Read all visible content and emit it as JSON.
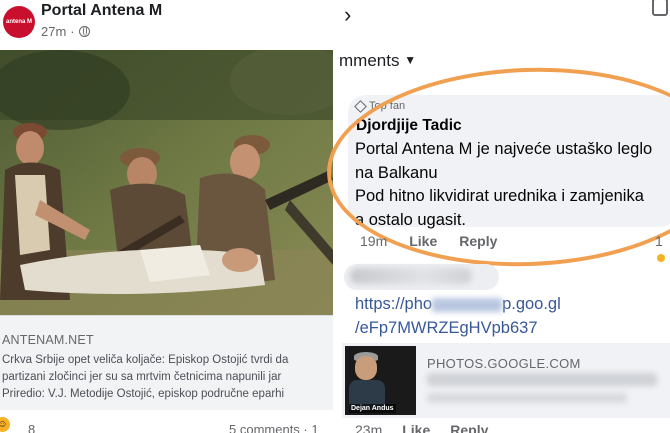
{
  "left_post": {
    "page_name": "Portal Antena M",
    "logo_text": "antena M",
    "time": "27m",
    "separator": "·",
    "link": {
      "domain": "ANTENAM.NET",
      "text_lines": [
        "Crkva Srbije opet veliča koljače: Episkop Ostojić tvrdi da",
        "partizani zločinci jer su sa mrtvim četnicima napunili jar",
        "Priredio: V.J. Metodije Ostojić, episkop područne eparhi"
      ]
    },
    "reactions": {
      "count": "8"
    },
    "comments_count": "5 comments · 1"
  },
  "right_panel": {
    "back_icon": "›",
    "comments_header": "mments",
    "comment": {
      "badge": "Top fan",
      "author": "Djordjije Tadic",
      "text_lines": [
        "Portal Antena M je najveće ustaško leglo",
        "na Balkanu",
        "Pod hitno likvidirat urednika i zamjenika",
        "a ostalo ugasit."
      ],
      "time": "19m",
      "like_label": "Like",
      "reply_label": "Reply",
      "reply_count": "1"
    },
    "reply": {
      "url_prefix": "https://",
      "url_mid": "pho",
      "url_suffix": "p.goo.gl",
      "url_line2": "/eFp7MWRZEgHVpb637",
      "preview_domain": "PHOTOS.GOOGLE.COM",
      "thumb_caption": "Dejan Andus",
      "time": "23m",
      "like_label": "Like",
      "reply_label": "Reply"
    }
  },
  "colors": {
    "highlight": "#f0a050",
    "link": "#385898",
    "brand": "#c8102e"
  }
}
